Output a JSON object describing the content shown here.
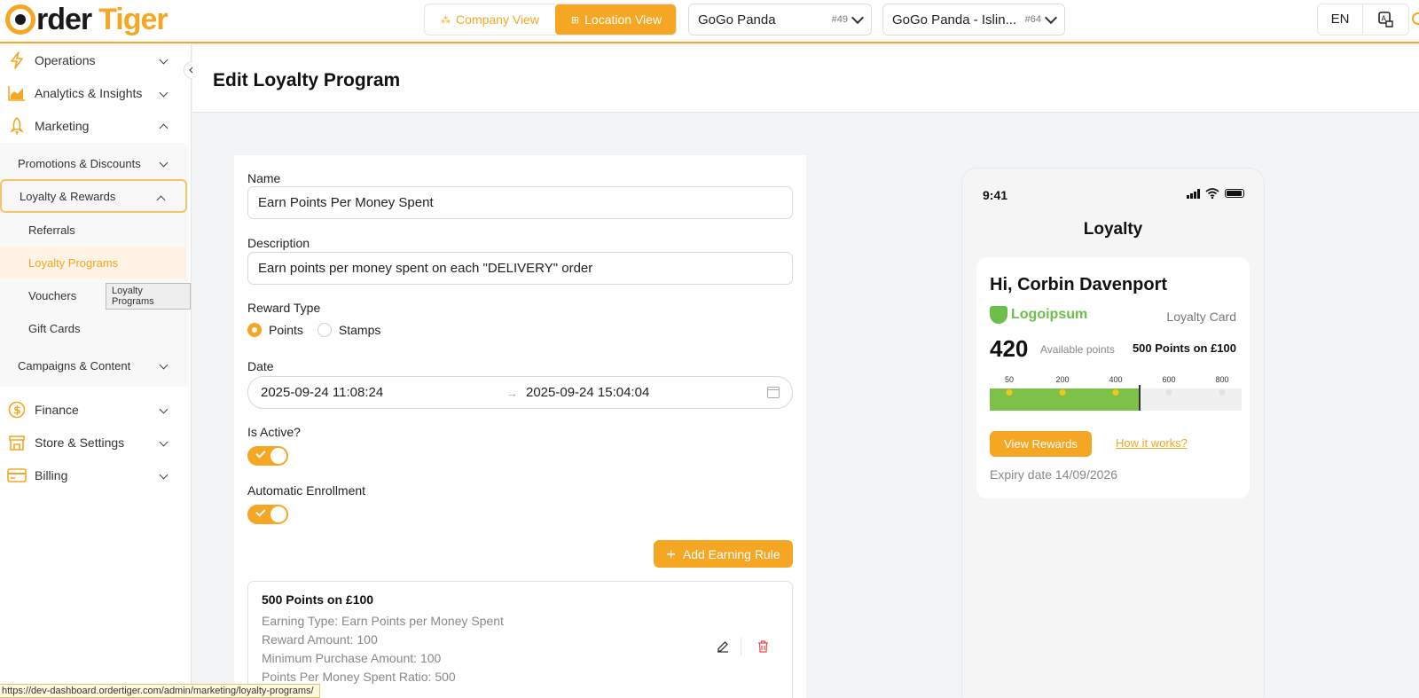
{
  "app": {
    "logo_text_1": "rder",
    "logo_text_2": "Tiger"
  },
  "header": {
    "company_view": "Company View",
    "location_view": "Location View",
    "company_select": {
      "value": "GoGo Panda",
      "id": "#49"
    },
    "location_select": {
      "value": "GoGo Panda - Islin...",
      "id": "#64"
    },
    "language": "EN"
  },
  "sidebar": {
    "operations": "Operations",
    "analytics": "Analytics & Insights",
    "marketing": "Marketing",
    "promotions": "Promotions & Discounts",
    "loyalty_rewards": "Loyalty & Rewards",
    "referrals": "Referrals",
    "loyalty_programs": "Loyalty Programs",
    "vouchers": "Vouchers",
    "gift_cards": "Gift Cards",
    "campaigns": "Campaigns & Content",
    "finance": "Finance",
    "store_settings": "Store & Settings",
    "billing": "Billing",
    "tooltip": "Loyalty Programs"
  },
  "page": {
    "title": "Edit Loyalty Program"
  },
  "form": {
    "name_label": "Name",
    "name_value": "Earn Points Per Money Spent",
    "description_label": "Description",
    "description_value": "Earn points per money spent on each \"DELIVERY\" order",
    "reward_type_label": "Reward Type",
    "reward_points": "Points",
    "reward_stamps": "Stamps",
    "reward_type_selected": "Points",
    "date_label": "Date",
    "date_start": "2025-09-24 11:08:24",
    "date_end": "2025-09-24 15:04:04",
    "date_arrow": "→",
    "is_active_label": "Is Active?",
    "is_active": true,
    "auto_enroll_label": "Automatic Enrollment",
    "auto_enroll": true,
    "add_rule_label": "Add Earning Rule",
    "rule": {
      "title": "500 Points on £100",
      "earning_type": "Earning Type: Earn Points per Money Spent",
      "reward_amount": "Reward Amount: 100",
      "minimum_purchase": "Minimum Purchase Amount: 100",
      "ratio": "Points Per Money Spent Ratio: 500"
    }
  },
  "preview": {
    "time": "9:41",
    "title": "Loyalty",
    "greeting": "Hi, Corbin Davenport",
    "brand": "Logoipsum",
    "card_type": "Loyalty Card",
    "points": "420",
    "points_caption": "Available points",
    "points_rule": "500 Points on £100",
    "milestones": [
      "50",
      "200",
      "400",
      "600",
      "800"
    ],
    "progress_fraction": 0.59,
    "view_rewards": "View Rewards",
    "how_it_works": "How it works?",
    "expiry": "Expiry date 14/09/2026"
  },
  "status_bar": {
    "url": "https://dev-dashboard.ordertiger.com/admin/marketing/loyalty-programs/"
  },
  "colors": {
    "accent": "#f5a623",
    "brand_green": "#6cc04a",
    "progress_green": "#7dc14a",
    "delete_red": "#e5484d"
  },
  "icons": {
    "operations": "lightning-icon",
    "analytics": "chart-icon",
    "marketing": "rocket-icon",
    "finance": "dollar-icon",
    "store": "store-icon",
    "billing": "credit-card-icon"
  }
}
